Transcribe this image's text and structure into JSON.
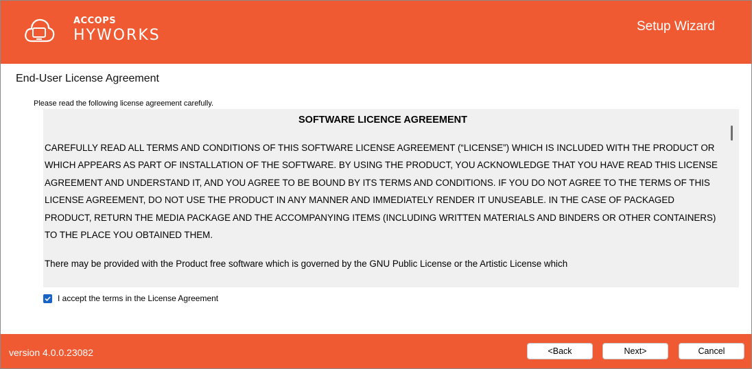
{
  "header": {
    "brand_top": "ACCOPS",
    "brand_main": "HYWORKS",
    "wizard_title": "Setup Wizard"
  },
  "section": {
    "title": "End-User License Agreement",
    "instruction": "Please read the following license agreement carefully."
  },
  "license": {
    "heading": "SOFTWARE LICENCE AGREEMENT",
    "paragraph1": "CAREFULLY READ ALL TERMS AND CONDITIONS OF THIS SOFTWARE LICENSE AGREEMENT (“LICENSE”) WHICH IS INCLUDED WITH THE PRODUCT OR WHICH APPEARS AS PART OF INSTALLATION OF THE SOFTWARE. BY USING THE PRODUCT, YOU ACKNOWLEDGE THAT YOU HAVE READ THIS LICENSE AGREEMENT AND UNDERSTAND IT, AND YOU AGREE TO BE BOUND BY ITS TERMS AND CONDITIONS. IF YOU DO NOT AGREE TO THE TERMS OF THIS LICENSE AGREEMENT, DO NOT USE THE PRODUCT IN ANY MANNER AND IMMEDIATELY RENDER IT UNUSEABLE. IN THE CASE OF PACKAGED PRODUCT, RETURN THE MEDIA PACKAGE AND THE ACCOMPANYING ITEMS (INCLUDING WRITTEN MATERIALS AND BINDERS OR OTHER CONTAINERS) TO THE PLACE YOU OBTAINED THEM.",
    "paragraph2": "There may be provided with the Product free software which is governed by the GNU Public License or the Artistic License which"
  },
  "accept": {
    "label": "I accept the terms in the License Agreement",
    "checked": true
  },
  "footer": {
    "version": "version 4.0.0.23082",
    "back_label": "<Back",
    "next_label": "Next>",
    "cancel_label": "Cancel"
  },
  "icons": {
    "logo": "cloud-monitor-icon",
    "checkbox": "check-icon"
  },
  "colors": {
    "brand": "#f05a32",
    "checkbox": "#1a63c6",
    "license_bg": "#f0f0f0"
  }
}
